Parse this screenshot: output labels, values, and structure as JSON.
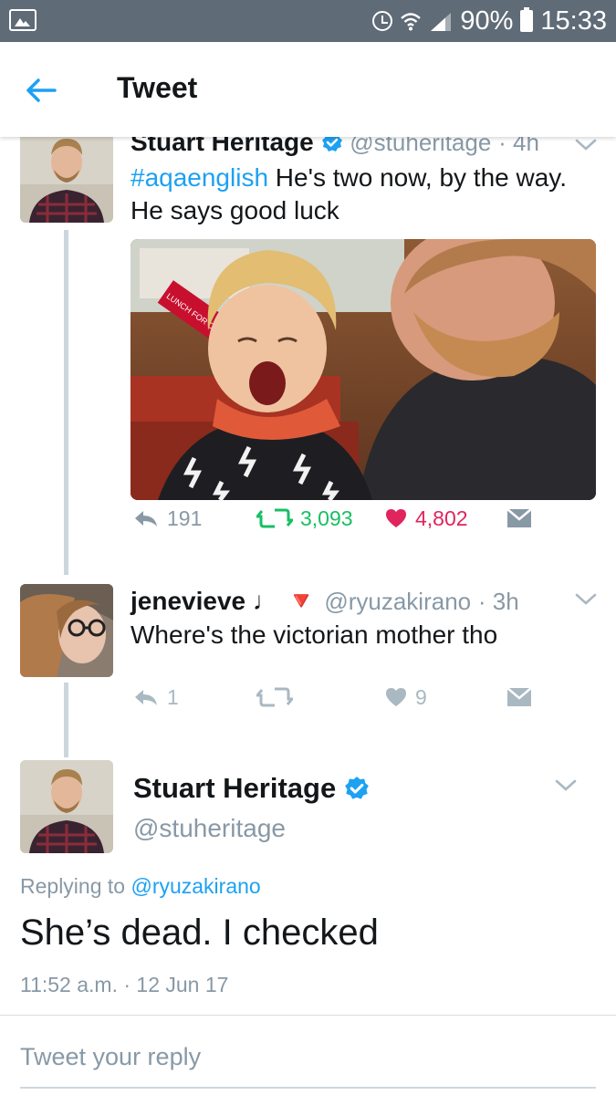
{
  "status_bar": {
    "battery": "90%",
    "time": "15:33",
    "icons": [
      "gallery-icon",
      "alarm-icon",
      "wifi-icon",
      "signal-icon",
      "battery-icon"
    ]
  },
  "header": {
    "title": "Tweet",
    "back_icon": "arrow-left-icon"
  },
  "colors": {
    "accent": "#1da1f2",
    "retweet": "#17bf63",
    "like": "#e0245e",
    "muted": "#8899a6",
    "status_bar": "#5f6b77"
  },
  "tweet1": {
    "name": "Stuart Heritage",
    "handle": "@stuheritage",
    "time": "· 4h",
    "hashtag": "#aqaenglish",
    "text_after_hashtag": " He's two now, by the way.",
    "text_line2": "He says good luck",
    "replies": "191",
    "retweets": "3,093",
    "likes": "4,802",
    "photo_sign_text": "LUNCH FOR ONE"
  },
  "tweet2": {
    "name": "jenevieve",
    "emoji": "♩ 🔻",
    "handle": "@ryuzakirano",
    "time": "· 3h",
    "text": "Where's the victorian mother tho",
    "replies": "1",
    "retweets": "",
    "likes": "9"
  },
  "main_tweet": {
    "name": "Stuart Heritage",
    "handle": "@stuheritage",
    "replying_prefix": "Replying to ",
    "replying_to": "@ryuzakirano",
    "text": "She’s dead. I checked",
    "timestamp": "11:52 a.m. · 12 Jun 17"
  },
  "reply": {
    "placeholder": "Tweet your reply"
  }
}
